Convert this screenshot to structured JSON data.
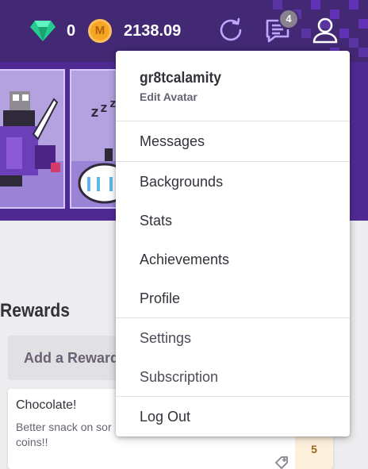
{
  "header": {
    "gems": "0",
    "gold": "2138.09",
    "coin_symbol": "M",
    "notification_count": "4",
    "icons": [
      "gem-icon",
      "gold-coin-icon",
      "refresh-icon",
      "messages-icon",
      "user-icon"
    ],
    "colors": {
      "bar": "#432874",
      "gem": "#24cc8f",
      "gold": "#f5a623"
    }
  },
  "dropdown": {
    "username": "gr8tcalamity",
    "edit_avatar": "Edit Avatar",
    "items": [
      "Messages",
      "Backgrounds",
      "Stats",
      "Achievements",
      "Profile",
      "Settings",
      "Subscription",
      "Log Out"
    ]
  },
  "rewards": {
    "title": "Rewards",
    "add_label": "Add a Reward",
    "card": {
      "title": "Chocolate!",
      "notes": "Better snack on sor coins!!",
      "cost": "5"
    }
  }
}
